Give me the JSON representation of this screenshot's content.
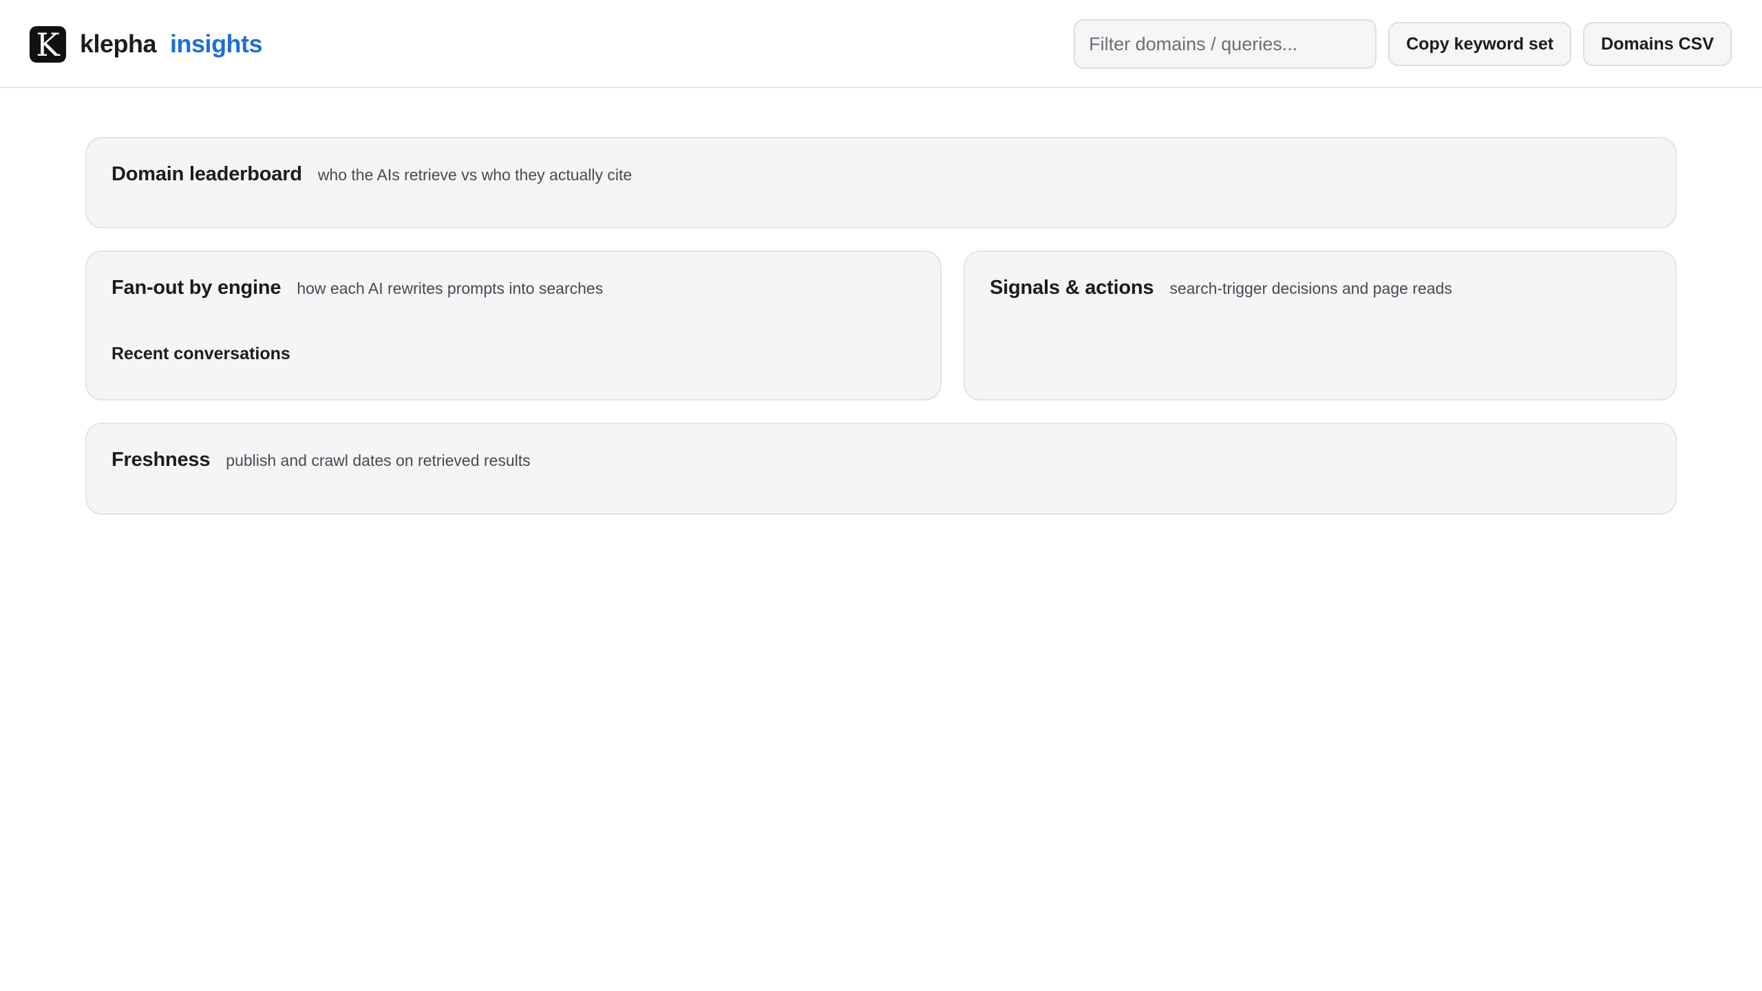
{
  "header": {
    "brand_mark": "K",
    "brand_name": "klepha",
    "brand_section": "insights",
    "filter_placeholder": "Filter domains / queries...",
    "copy_keyword_label": "Copy keyword set",
    "domains_csv_label": "Domains CSV"
  },
  "colors": {
    "accent": "#1f6fd6",
    "card_background": "#f4f5f7",
    "border": "#e3e4e8"
  },
  "cards": {
    "leaderboard": {
      "title": "Domain leaderboard",
      "subtitle": "who the AIs retrieve vs who they actually cite"
    },
    "fanout": {
      "title": "Fan-out by engine",
      "subtitle": "how each AI rewrites prompts into searches",
      "section_label": "Recent conversations"
    },
    "signals": {
      "title": "Signals & actions",
      "subtitle": "search-trigger decisions and page reads"
    },
    "freshness": {
      "title": "Freshness",
      "subtitle": "publish and crawl dates on retrieved results"
    }
  }
}
